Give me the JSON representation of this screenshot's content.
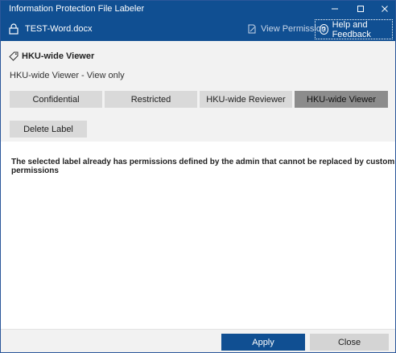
{
  "window": {
    "title": "Information Protection File Labeler"
  },
  "header": {
    "filename": "TEST-Word.docx",
    "view_permission": "View Permission",
    "help_feedback": "Help and Feedback"
  },
  "label": {
    "name": "HKU-wide Viewer",
    "description": "HKU-wide Viewer - View only",
    "options": [
      {
        "label": "Confidential",
        "selected": false
      },
      {
        "label": "Restricted",
        "selected": false
      },
      {
        "label": "HKU-wide Reviewer",
        "selected": false
      },
      {
        "label": "HKU-wide Viewer",
        "selected": true
      }
    ],
    "delete_label": "Delete Label"
  },
  "message": "The selected label already has permissions defined by the admin that cannot be replaced by custom permissions",
  "footer": {
    "apply": "Apply",
    "close": "Close"
  },
  "colors": {
    "header_blue": "#104f92",
    "selected_gray": "#8c8c8c",
    "button_gray": "#d9d9d9"
  }
}
